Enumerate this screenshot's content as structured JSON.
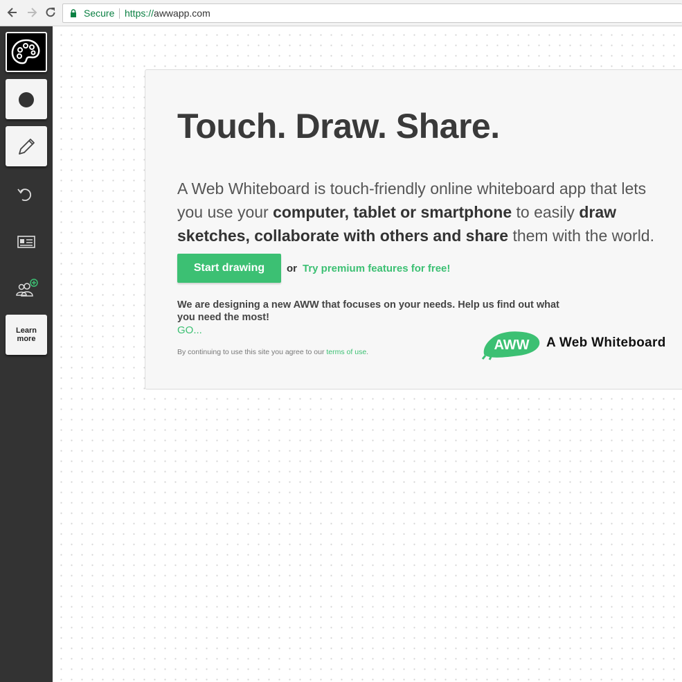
{
  "browser": {
    "secure_label": "Secure",
    "url_scheme": "https://",
    "url_host": "awwapp.com"
  },
  "sidebar": {
    "icons": [
      "palette-icon",
      "circle-icon",
      "pencil-icon",
      "undo-icon",
      "id-card-icon",
      "add-users-icon"
    ],
    "learn_more_line1": "Learn",
    "learn_more_line2": "more"
  },
  "card": {
    "headline": "Touch. Draw. Share.",
    "intro_part1": "A Web Whiteboard is touch-friendly online whiteboard app that lets you use your ",
    "intro_bold1": "computer, tablet or smartphone",
    "intro_part2": " to easily ",
    "intro_bold2": "draw sketches, collaborate with others and share",
    "intro_part3": " them with the world.",
    "start_button": "Start drawing",
    "or_text": "or",
    "premium_link": "Try premium features for free!",
    "designing_text": "We are designing a new AWW that focuses on your needs. Help us find out what you need the most!",
    "go_link": "GO...",
    "agree_text": "By continuing to use this site you agree to our ",
    "terms_link": "terms of use",
    "agree_end": "."
  },
  "logo": {
    "badge_text": "AWW",
    "name": "A Web Whiteboard",
    "accent": "#3cc073"
  }
}
